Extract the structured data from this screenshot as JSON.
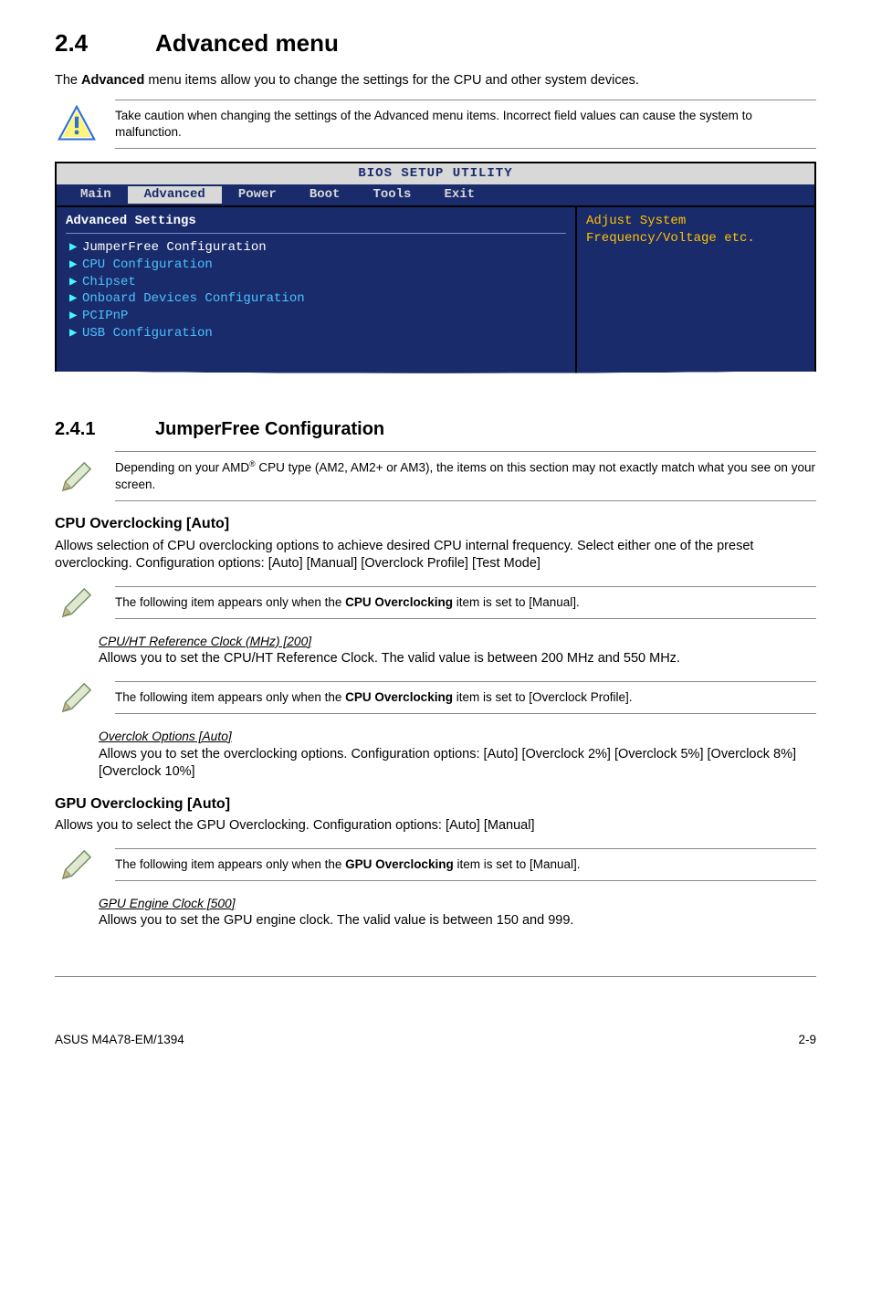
{
  "section": {
    "num": "2.4",
    "title": "Advanced menu"
  },
  "intro": {
    "pre": "The ",
    "bold": "Advanced",
    "post": " menu items allow you to change the settings for the CPU and other system devices."
  },
  "caution_text": "Take caution when changing the settings of the Advanced menu items. Incorrect field values can cause the system to malfunction.",
  "bios": {
    "title": "BIOS SETUP UTILITY",
    "tabs": [
      "Main",
      "Advanced",
      "Power",
      "Boot",
      "Tools",
      "Exit"
    ],
    "section_label": "Advanced Settings",
    "items": [
      "JumperFree Configuration",
      "CPU Configuration",
      "Chipset",
      "Onboard Devices Configuration",
      "PCIPnP",
      "USB Configuration"
    ],
    "help": "Adjust System Frequency/Voltage etc."
  },
  "subsection": {
    "num": "2.4.1",
    "title": "JumperFree Configuration"
  },
  "amd_note": {
    "pre": "Depending on your AMD",
    "sup": "®",
    "post": " CPU type (AM2, AM2+ or AM3), the items on this section may not exactly match what you see on your screen."
  },
  "cpu_oc": {
    "heading": "CPU Overclocking [Auto]",
    "body": "Allows selection of CPU overclocking options to achieve desired CPU internal frequency. Select either one of the preset overclocking. Configuration options: [Auto] [Manual] [Overclock Profile] [Test Mode]"
  },
  "manual_note": {
    "pre": "The following item appears only when the ",
    "bold": "CPU Overclocking",
    "post": " item is set to [Manual]."
  },
  "cpu_ht": {
    "head": "CPU/HT Reference Clock (MHz) [200]",
    "body": "Allows you to set the CPU/HT Reference Clock. The valid value is between 200 MHz and 550 MHz."
  },
  "profile_note": {
    "pre": "The following item appears only when the ",
    "bold": "CPU Overclocking",
    "post": " item is set to [Overclock Profile]."
  },
  "oc_opts": {
    "head": "Overclok Options [Auto]",
    "body": "Allows you to set the overclocking options. Configuration options: [Auto] [Overclock 2%] [Overclock 5%] [Overclock 8%] [Overclock 10%]"
  },
  "gpu_oc": {
    "heading": "GPU Overclocking [Auto]",
    "body": "Allows you to select the GPU Overclocking. Configuration options: [Auto] [Manual]"
  },
  "gpu_note": {
    "pre": "The following item appears only when the ",
    "bold": "GPU Overclocking",
    "post": " item is set to [Manual]."
  },
  "gpu_engine": {
    "head": "GPU Engine Clock [500]",
    "body": "Allows you to set the GPU engine clock. The valid value is between 150 and 999."
  },
  "footer": {
    "left": "ASUS M4A78-EM/1394",
    "right": "2-9"
  }
}
